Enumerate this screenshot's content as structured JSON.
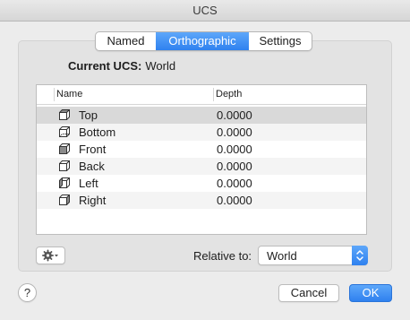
{
  "window": {
    "title": "UCS"
  },
  "tabs": [
    {
      "label": "Named"
    },
    {
      "label": "Orthographic",
      "selected": true
    },
    {
      "label": "Settings"
    }
  ],
  "current": {
    "label": "Current UCS:",
    "value": "World"
  },
  "table": {
    "columns": [
      "Name",
      "Depth"
    ],
    "rows": [
      {
        "name": "Top",
        "depth": "0.0000",
        "icon": "cube-top-icon",
        "selected": true
      },
      {
        "name": "Bottom",
        "depth": "0.0000",
        "icon": "cube-bottom-icon"
      },
      {
        "name": "Front",
        "depth": "0.0000",
        "icon": "cube-front-icon"
      },
      {
        "name": "Back",
        "depth": "0.0000",
        "icon": "cube-back-icon"
      },
      {
        "name": "Left",
        "depth": "0.0000",
        "icon": "cube-left-icon"
      },
      {
        "name": "Right",
        "depth": "0.0000",
        "icon": "cube-right-icon"
      }
    ]
  },
  "relative": {
    "label": "Relative to:",
    "value": "World"
  },
  "footer": {
    "help_label": "?",
    "cancel_label": "Cancel",
    "ok_label": "OK"
  },
  "colors": {
    "accent": "#3a8cf5",
    "selected_row": "#d9d9d9"
  }
}
